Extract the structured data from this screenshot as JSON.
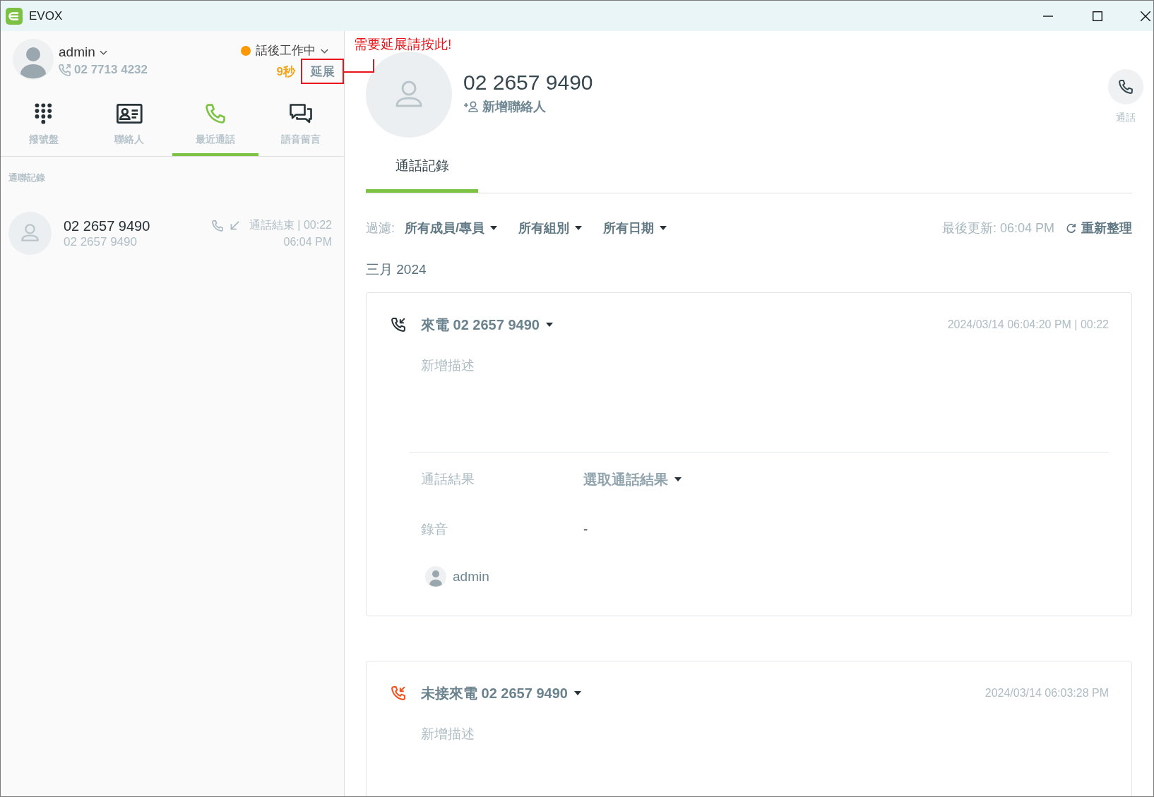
{
  "window": {
    "title": "EVOX"
  },
  "agent": {
    "name": "admin",
    "extension": "02 7713 4232",
    "status": "話後工作中",
    "timer": "9秒",
    "extend_button": "延展"
  },
  "annotation": {
    "text": "需要延展請按此!"
  },
  "nav_tabs": [
    {
      "kind": "dialpad",
      "label": "撥號盤",
      "selected": false
    },
    {
      "kind": "contacts",
      "label": "聯絡人",
      "selected": false
    },
    {
      "kind": "recent",
      "label": "最近通話",
      "selected": true
    },
    {
      "kind": "voicemail",
      "label": "語音留言",
      "selected": false
    }
  ],
  "history": {
    "title": "通聯記錄",
    "items": [
      {
        "name": "02 2657 9490",
        "number": "02 2657 9490",
        "incoming": true,
        "result": "通話結束 | 00:22",
        "time": "06:04 PM"
      }
    ]
  },
  "contact": {
    "number": "02 2657 9490",
    "add_contact": "新增聯絡人",
    "call_label": "通話"
  },
  "detail_tabs": [
    {
      "label": "通話記錄",
      "selected": true
    }
  ],
  "filters": {
    "label": "過濾:",
    "dropdowns": [
      "所有成員/專員",
      "所有組別",
      "所有日期"
    ],
    "last_updated": "最後更新: 06:04 PM",
    "refresh": "重新整理"
  },
  "month": "三月 2024",
  "calls": [
    {
      "kind": "incoming",
      "title": "來電 02 2657 9490",
      "timestamp": "2024/03/14 06:04:20 PM | 00:22",
      "description": {
        "placeholder": "新增描述"
      },
      "details": {
        "result_label": "通話結果",
        "result_dropdown": "選取通話結果",
        "recording_label": "錄音",
        "recording_value": "-",
        "agent": "admin"
      }
    },
    {
      "kind": "missed",
      "title": "未接來電 02 2657 9490",
      "timestamp": "2024/03/14 06:03:28 PM",
      "description": {
        "placeholder": "新增描述"
      }
    }
  ]
}
